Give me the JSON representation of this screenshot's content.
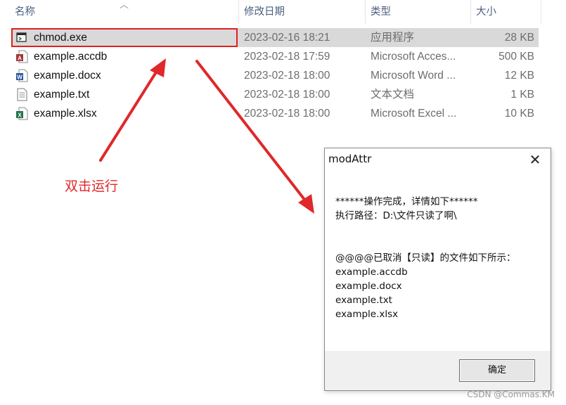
{
  "explorer": {
    "columns": [
      "名称",
      "修改日期",
      "类型",
      "大小"
    ],
    "files": [
      {
        "icon": "exe-icon",
        "name": "chmod.exe",
        "date": "2023-02-16 18:21",
        "type": "应用程序",
        "size": "28 KB",
        "selected": true
      },
      {
        "icon": "access-icon",
        "name": "example.accdb",
        "date": "2023-02-18 17:59",
        "type": "Microsoft Acces...",
        "size": "500 KB",
        "selected": false
      },
      {
        "icon": "word-icon",
        "name": "example.docx",
        "date": "2023-02-18 18:00",
        "type": "Microsoft Word ...",
        "size": "12 KB",
        "selected": false
      },
      {
        "icon": "text-file-icon",
        "name": "example.txt",
        "date": "2023-02-18 18:00",
        "type": "文本文档",
        "size": "1 KB",
        "selected": false
      },
      {
        "icon": "excel-icon",
        "name": "example.xlsx",
        "date": "2023-02-18 18:00",
        "type": "Microsoft Excel ...",
        "size": "10 KB",
        "selected": false
      }
    ]
  },
  "annotation": {
    "text": "双击运行",
    "color": "#e0282a"
  },
  "dialog": {
    "title": "modAttr",
    "lines_top": [
      "******操作完成，详情如下******",
      "执行路径：D:\\文件只读了啊\\"
    ],
    "lines_bottom": [
      "@@@@已取消【只读】的文件如下所示：",
      "example.accdb",
      "example.docx",
      "example.txt",
      "example.xlsx"
    ],
    "ok_label": "确定"
  },
  "watermark": "CSDN @Commas.KM"
}
